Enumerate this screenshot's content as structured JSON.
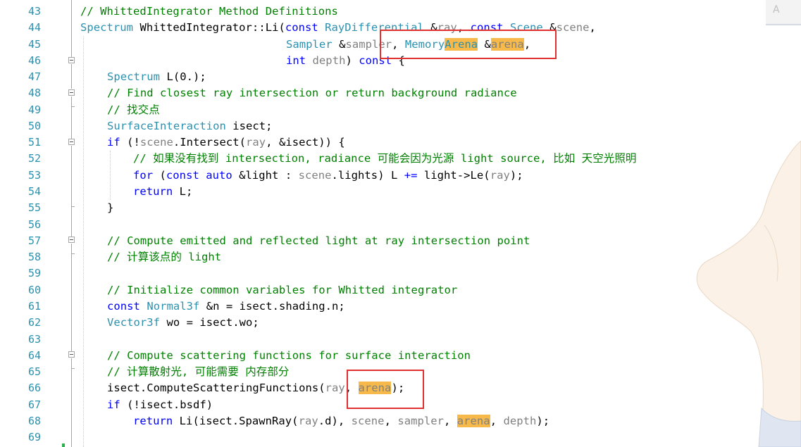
{
  "editor": {
    "line_numbers": [
      "43",
      "44",
      "45",
      "46",
      "47",
      "48",
      "49",
      "50",
      "51",
      "52",
      "53",
      "54",
      "55",
      "56",
      "57",
      "58",
      "59",
      "60",
      "61",
      "62",
      "63",
      "64",
      "65",
      "66",
      "67",
      "68",
      "69"
    ],
    "scroll_corner_label": "A",
    "lines": {
      "l43": {
        "c": "// WhittedIntegrator Method Definitions"
      },
      "l44": {
        "a": "Spectrum",
        "b": " WhittedIntegrator::Li(",
        "c": "const",
        "d": " ",
        "e": "RayDifferential",
        "f": " &",
        "g": "ray",
        "h": ", ",
        "i": "const",
        "j": " ",
        "k": "Scene",
        "l": " &",
        "m": "scene",
        "n": ","
      },
      "l45": {
        "a": "Sampler",
        "b": " &",
        "c": "sampler",
        "d": ", ",
        "e": "Memory",
        "f": "Arena",
        "g": " &",
        "h": "arena",
        "i": ","
      },
      "l46": {
        "a": "int",
        "b": " ",
        "c": "depth",
        "d": ") ",
        "e": "const",
        "f": " {"
      },
      "l47": {
        "a": "Spectrum",
        "b": " L(0.);"
      },
      "l48": {
        "c": "// Find closest ray intersection or return background radiance"
      },
      "l49": {
        "c": "// 找交点"
      },
      "l50": {
        "a": "SurfaceInteraction",
        "b": " isect;"
      },
      "l51": {
        "a": "if",
        "b": " (!",
        "c": "scene",
        "d": ".Intersect(",
        "e": "ray",
        "f": ", &isect)) {"
      },
      "l52": {
        "c": "// 如果没有找到 intersection, radiance 可能会因为光源 light source, 比如 天空光照明"
      },
      "l53": {
        "a": "for",
        "b": " (",
        "c": "const",
        "d": " ",
        "e": "auto",
        "f": " &light : ",
        "g": "scene",
        "h": ".lights) L ",
        "i": "+=",
        "j": " light->Le(",
        "k": "ray",
        "l": ");"
      },
      "l54": {
        "a": "return",
        "b": " L;"
      },
      "l55": {
        "b": "}"
      },
      "l57": {
        "c": "// Compute emitted and reflected light at ray intersection point"
      },
      "l58": {
        "c": "// 计算该点的 light"
      },
      "l60": {
        "c": "// Initialize common variables for Whitted integrator"
      },
      "l61": {
        "a": "const",
        "b": " ",
        "c": "Normal3f",
        "d": " &n = isect.shading.n;"
      },
      "l62": {
        "a": "Vector3f",
        "b": " wo = isect.wo;"
      },
      "l64": {
        "c": "// Compute scattering functions for surface interaction"
      },
      "l65": {
        "c": "// 计算散射光, 可能需要 内存部分"
      },
      "l66": {
        "a": "isect.ComputeScatteringFunctions(",
        "b": "ray",
        "c": ", ",
        "d": "arena",
        "e": ");"
      },
      "l67": {
        "a": "if",
        "b": " (!isect.bsdf)"
      },
      "l68": {
        "a": "return",
        "b": " Li(isect.SpawnRay(",
        "c": "ray",
        "d": ".d), ",
        "e": "scene",
        "f": ", ",
        "g": "sampler",
        "h": ", ",
        "i": "arena",
        "j": ", ",
        "k": "depth",
        "l": ");"
      }
    }
  },
  "colors": {
    "comment": "#008000",
    "keyword": "#0000ff",
    "type": "#2b91af",
    "parameter": "#808080",
    "line_number": "#2b91af",
    "highlight": "#f6b94a",
    "annotation_box": "#e03030"
  }
}
